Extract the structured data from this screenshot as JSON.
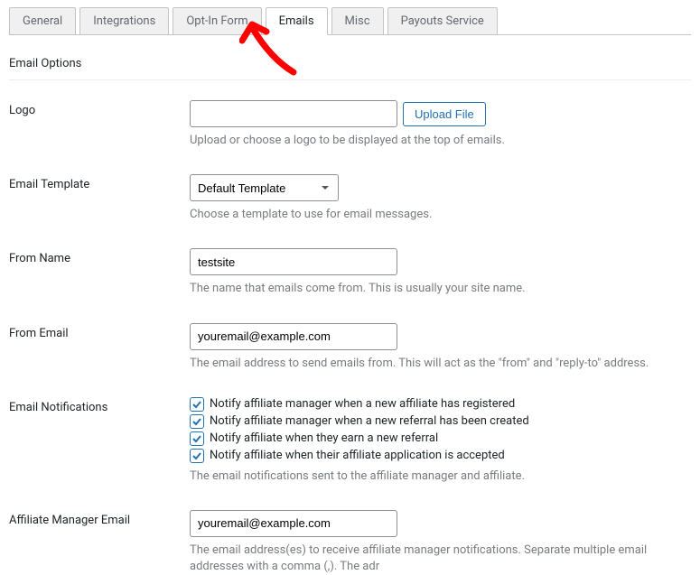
{
  "tabs": [
    {
      "label": "General",
      "active": false
    },
    {
      "label": "Integrations",
      "active": false
    },
    {
      "label": "Opt-In Form",
      "active": false
    },
    {
      "label": "Emails",
      "active": true
    },
    {
      "label": "Misc",
      "active": false
    },
    {
      "label": "Payouts Service",
      "active": false
    }
  ],
  "section_title": "Email Options",
  "logo": {
    "label": "Logo",
    "value": "",
    "upload": "Upload File",
    "help": "Upload or choose a logo to be displayed at the top of emails."
  },
  "template": {
    "label": "Email Template",
    "value": "Default Template",
    "help": "Choose a template to use for email messages."
  },
  "from_name": {
    "label": "From Name",
    "value": "testsite",
    "help": "The name that emails come from. This is usually your site name."
  },
  "from_email": {
    "label": "From Email",
    "value": "youremail@example.com",
    "help": "The email address to send emails from. This will act as the \"from\" and \"reply-to\" address."
  },
  "notifications": {
    "label": "Email Notifications",
    "items": [
      {
        "checked": true,
        "label": "Notify affiliate manager when a new affiliate has registered"
      },
      {
        "checked": true,
        "label": "Notify affiliate manager when a new referral has been created"
      },
      {
        "checked": true,
        "label": "Notify affiliate when they earn a new referral"
      },
      {
        "checked": true,
        "label": "Notify affiliate when their affiliate application is accepted"
      }
    ],
    "help": "The email notifications sent to the affiliate manager and affiliate."
  },
  "manager_email": {
    "label": "Affiliate Manager Email",
    "value": "youremail@example.com",
    "help": "The email address(es) to receive affiliate manager notifications. Separate multiple email addresses with a comma (,). The adr"
  }
}
